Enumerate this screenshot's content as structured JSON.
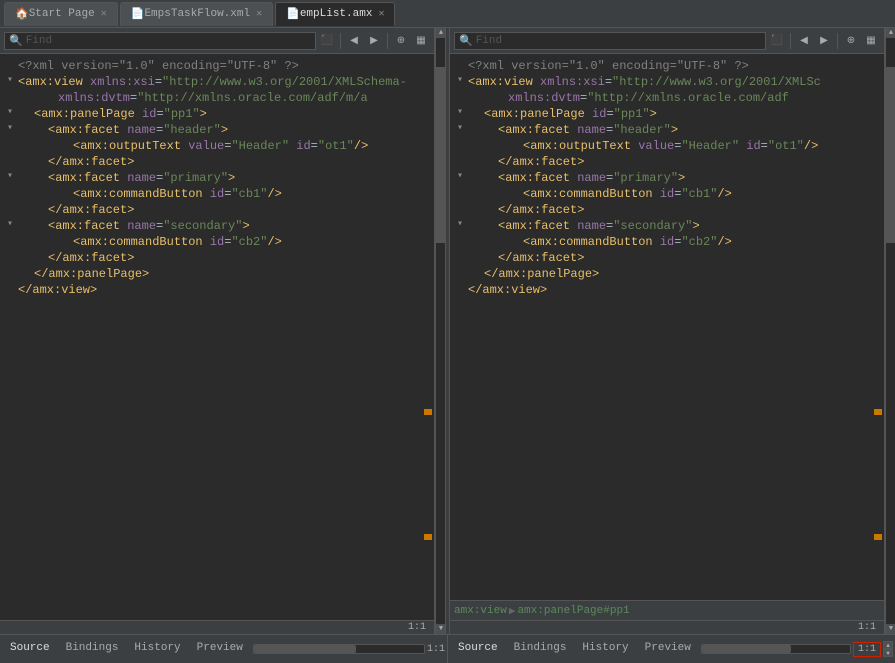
{
  "tabs": [
    {
      "id": "start",
      "label": "Start Page",
      "icon": "🏠",
      "active": false,
      "closable": true
    },
    {
      "id": "emps-task",
      "label": "EmpsTaskFlow.xml",
      "icon": "📄",
      "active": false,
      "closable": true
    },
    {
      "id": "emplist",
      "label": "empList.amx",
      "icon": "📄",
      "active": true,
      "closable": true
    }
  ],
  "left_editor": {
    "toolbar": {
      "search_placeholder": "Find",
      "buttons": [
        "⬛",
        "◀",
        "▶",
        "⊕",
        "▦"
      ]
    },
    "code_lines": [
      {
        "indent": 0,
        "fold": false,
        "content": "<?xml version=\"1.0\" encoding=\"UTF-8\" ?>"
      },
      {
        "indent": 0,
        "fold": true,
        "content": "<amx:view xmlns:xsi=\"http://www.w3.org/2001/XMLSchema-"
      },
      {
        "indent": 4,
        "fold": false,
        "content": "xmlns:dvtm=\"http://xmlns.oracle.com/adf/m/a"
      },
      {
        "indent": 2,
        "fold": true,
        "content": "<amx:panelPage id=\"pp1\">"
      },
      {
        "indent": 4,
        "fold": true,
        "content": "<amx:facet name=\"header\">"
      },
      {
        "indent": 6,
        "fold": false,
        "content": "<amx:outputText value=\"Header\" id=\"ot1\"/>"
      },
      {
        "indent": 4,
        "fold": false,
        "content": "</amx:facet>"
      },
      {
        "indent": 4,
        "fold": true,
        "content": "<amx:facet name=\"primary\">"
      },
      {
        "indent": 6,
        "fold": false,
        "content": "<amx:commandButton id=\"cb1\"/>"
      },
      {
        "indent": 4,
        "fold": false,
        "content": "</amx:facet>"
      },
      {
        "indent": 4,
        "fold": true,
        "content": "<amx:facet name=\"secondary\">"
      },
      {
        "indent": 6,
        "fold": false,
        "content": "<amx:commandButton id=\"cb2\"/>"
      },
      {
        "indent": 4,
        "fold": false,
        "content": "</amx:facet>"
      },
      {
        "indent": 2,
        "fold": false,
        "content": "</amx:panelPage>"
      },
      {
        "indent": 0,
        "fold": false,
        "content": "</amx:view>"
      }
    ],
    "status_tabs": [
      "Source",
      "Bindings",
      "History",
      "Preview"
    ],
    "active_status_tab": "Source",
    "position": "1:1"
  },
  "right_editor": {
    "toolbar": {
      "search_placeholder": "Find",
      "buttons": [
        "⬛",
        "◀",
        "▶",
        "⊕",
        "▦"
      ]
    },
    "code_lines": [
      {
        "indent": 0,
        "fold": false,
        "content": "<?xml version=\"1.0\" encoding=\"UTF-8\" ?>"
      },
      {
        "indent": 0,
        "fold": true,
        "content": "<amx:view xmlns:xsi=\"http://www.w3.org/2001/XMLSc"
      },
      {
        "indent": 4,
        "fold": false,
        "content": "xmlns:dvtm=\"http://xmlns.oracle.com/adf"
      },
      {
        "indent": 2,
        "fold": true,
        "content": "<amx:panelPage id=\"pp1\">"
      },
      {
        "indent": 4,
        "fold": true,
        "content": "<amx:facet name=\"header\">"
      },
      {
        "indent": 6,
        "fold": false,
        "content": "<amx:outputText value=\"Header\" id=\"ot1\"/>"
      },
      {
        "indent": 4,
        "fold": false,
        "content": "</amx:facet>"
      },
      {
        "indent": 4,
        "fold": true,
        "content": "<amx:facet name=\"primary\">"
      },
      {
        "indent": 6,
        "fold": false,
        "content": "<amx:commandButton id=\"cb1\"/>"
      },
      {
        "indent": 4,
        "fold": false,
        "content": "</amx:facet>"
      },
      {
        "indent": 4,
        "fold": true,
        "content": "<amx:facet name=\"secondary\">"
      },
      {
        "indent": 6,
        "fold": false,
        "content": "<amx:commandButton id=\"cb2\"/>"
      },
      {
        "indent": 4,
        "fold": false,
        "content": "</amx:facet>"
      },
      {
        "indent": 2,
        "fold": false,
        "content": "</amx:panelPage>"
      },
      {
        "indent": 0,
        "fold": false,
        "content": "</amx:view>"
      }
    ],
    "breadcrumb": [
      "amx:view",
      "amx:panelPage#pp1"
    ],
    "status_tabs": [
      "Source",
      "Bindings",
      "History",
      "Preview"
    ],
    "active_status_tab": "Source",
    "position": "1:1"
  }
}
